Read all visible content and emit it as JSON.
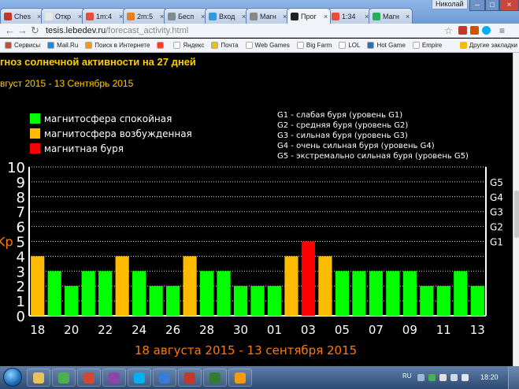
{
  "browser": {
    "user_name": "Николай",
    "tabs": [
      {
        "title": "Ches",
        "color": "#c0392b"
      },
      {
        "title": "Откр",
        "color": "#e8e8e8"
      },
      {
        "title": "1m:4",
        "color": "#e74c3c"
      },
      {
        "title": "2m:5",
        "color": "#e67e22"
      },
      {
        "title": "Бесп",
        "color": "#7f8c8d"
      },
      {
        "title": "Вход",
        "color": "#3498db"
      },
      {
        "title": "Магн",
        "color": "#888888"
      },
      {
        "title": "Прог",
        "color": "#222222"
      },
      {
        "title": "1:34",
        "color": "#e74c3c"
      },
      {
        "title": "Магн",
        "color": "#27ae60"
      }
    ],
    "active_tab": 7,
    "url_host": "tesis.lebedev.ru",
    "url_path": "/forecast_activity.html",
    "bookmarks": [
      {
        "label": "Сервисы",
        "color": "#d14836"
      },
      {
        "label": "Mail.Ru",
        "color": "#168de2"
      },
      {
        "label": "Поиск в Интернете",
        "color": "#ff9900"
      },
      {
        "label": "",
        "color": "#fc3f1d"
      },
      {
        "label": "Яндекс",
        "color": "#ffffff"
      },
      {
        "label": "Почта",
        "color": "#f0c000"
      },
      {
        "label": "Web Games",
        "color": "#ffffff"
      },
      {
        "label": "Big Farm",
        "color": "#ffffff"
      },
      {
        "label": "LOL",
        "color": "#ffffff"
      },
      {
        "label": "Hot Game",
        "color": "#2a6ebb"
      },
      {
        "label": "Empire",
        "color": "#ffffff"
      }
    ],
    "other_bookmarks": "Другие закладки"
  },
  "page": {
    "title": "гноз солнечной активности на 27 дней",
    "period": "вгуст 2015 - 13 Сентябрь 2015"
  },
  "legend": {
    "items": [
      {
        "label": "магнитосфера спокойная",
        "color": "#00ff00"
      },
      {
        "label": "магнитосфера возбужденная",
        "color": "#ffbb00"
      },
      {
        "label": "магнитная буря",
        "color": "#ff0000"
      }
    ],
    "storm_levels": [
      "G1 - слабая буря (уровень G1)",
      "G2 - средняя буря (уровень G2)",
      "G3 - сильная буря (уровень G3)",
      "G4 - очень сильная буря (уровень G4)",
      "G5 - экстремально сильная буря (уровень G5)"
    ]
  },
  "chart_data": {
    "type": "bar",
    "title": "18 августа 2015 - 13 сентября 2015",
    "ylabel": "Kp",
    "ylim": [
      0,
      10
    ],
    "y_ticks": [
      "0",
      "1",
      "2",
      "3",
      "4",
      "5",
      "6",
      "7",
      "8",
      "9",
      "10"
    ],
    "right_ticks": [
      {
        "label": "G1",
        "level": 5
      },
      {
        "label": "G2",
        "level": 6
      },
      {
        "label": "G3",
        "level": 7
      },
      {
        "label": "G4",
        "level": 8
      },
      {
        "label": "G5",
        "level": 9
      }
    ],
    "x_tick_labels": [
      "18",
      "20",
      "22",
      "24",
      "26",
      "28",
      "30",
      "01",
      "03",
      "05",
      "07",
      "09",
      "11",
      "13"
    ],
    "values": [
      4,
      3,
      2,
      3,
      3,
      4,
      3,
      2,
      2,
      4,
      3,
      3,
      2,
      2,
      2,
      4,
      5,
      4,
      3,
      3,
      3,
      3,
      3,
      2,
      2,
      3,
      2
    ],
    "bar_colors": {
      "calm": "#00ff00",
      "disturbed": "#ffbb00",
      "storm": "#ff0000"
    },
    "grid": true
  },
  "taskbar": {
    "apps": [
      {
        "name": "explorer",
        "color": "#e8c25a"
      },
      {
        "name": "chrome",
        "color": "#4caf50"
      },
      {
        "name": "yandex-browser",
        "color": "#d14836"
      },
      {
        "name": "mail-agent",
        "color": "#8e44ad"
      },
      {
        "name": "skype",
        "color": "#00aff0"
      },
      {
        "name": "media",
        "color": "#3a7bd5"
      },
      {
        "name": "game",
        "color": "#c0392b"
      },
      {
        "name": "office",
        "color": "#2e7d32"
      },
      {
        "name": "paint",
        "color": "#f39c12"
      }
    ],
    "language": "RU",
    "time": "18:20"
  }
}
